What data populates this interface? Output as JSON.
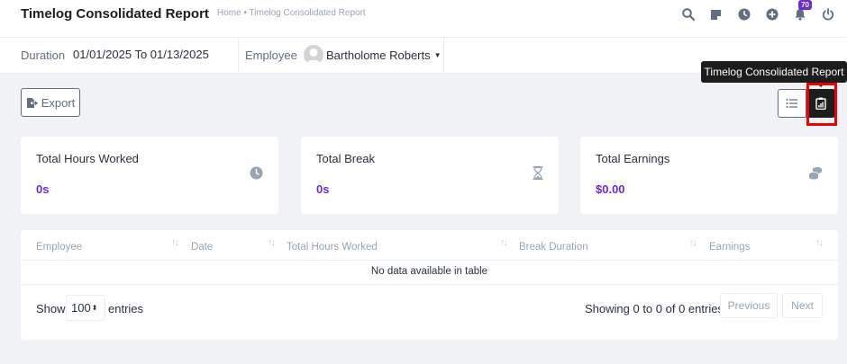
{
  "header": {
    "title": "Timelog Consolidated Report",
    "breadcrumb": "Home • Timelog Consolidated Report",
    "notification_count": "70",
    "icons": [
      "search-icon",
      "sticky-note-icon",
      "clock-icon",
      "plus-circle-icon",
      "bell-icon",
      "power-icon"
    ]
  },
  "filters": {
    "duration_label": "Duration",
    "duration_value": "01/01/2025 To 01/13/2025",
    "employee_label": "Employee",
    "employee_name": "Bartholome Roberts"
  },
  "toolbar": {
    "export_label": "Export",
    "tooltip": "Timelog Consolidated Report"
  },
  "stats": [
    {
      "title": "Total Hours Worked",
      "value": "0s",
      "icon": "clock-icon"
    },
    {
      "title": "Total Break",
      "value": "0s",
      "icon": "hourglass-icon"
    },
    {
      "title": "Total Earnings",
      "value": "$0.00",
      "icon": "coins-icon"
    }
  ],
  "table": {
    "columns": [
      "Employee",
      "Date",
      "Total Hours Worked",
      "Break Duration",
      "Earnings"
    ],
    "empty_message": "No data available in table",
    "show_label": "Show",
    "entries_label": "entries",
    "page_length": "100",
    "info": "Showing 0 to 0 of 0 entries",
    "previous": "Previous",
    "next": "Next"
  },
  "colors": {
    "accent": "#6c2bd9",
    "highlight": "#e00000",
    "dark": "#1d1d1d"
  }
}
